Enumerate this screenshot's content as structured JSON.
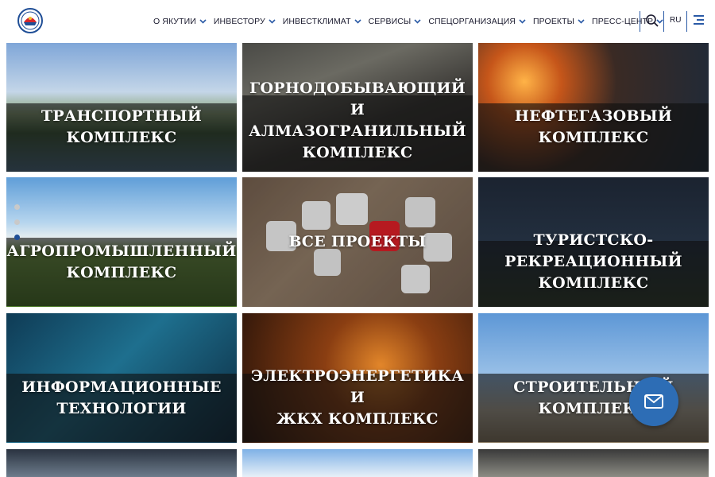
{
  "header": {
    "nav": [
      {
        "label": "О ЯКУТИИ"
      },
      {
        "label": "ИНВЕСТОРУ"
      },
      {
        "label": "ИНВЕСТКЛИМАТ"
      },
      {
        "label": "СЕРВИСЫ"
      },
      {
        "label": "СПЕЦОРГАНИЗАЦИЯ"
      },
      {
        "label": "ПРОЕКТЫ"
      },
      {
        "label": "ПРЕСС-ЦЕНТР"
      }
    ],
    "language": "RU",
    "icons": {
      "logo": "emblem-icon",
      "search": "search-icon",
      "menu": "hamburger-menu-icon"
    },
    "accent_color": "#2a5aa6"
  },
  "tiles": [
    {
      "label": "ТРАНСПОРТНЫЙ\nКОМПЛЕКС"
    },
    {
      "label": "ГОРНОДОБЫВАЮЩИЙ И\nАЛМАЗОГРАНИЛЬНЫЙ\nКОМПЛЕКС"
    },
    {
      "label": "НЕФТЕГАЗОВЫЙ\nКОМПЛЕКС"
    },
    {
      "label": "АГРОПРОМЫШЛЕННЫЙ\nКОМПЛЕКС"
    },
    {
      "label": "ВСЕ ПРОЕКТЫ"
    },
    {
      "label": "ТУРИСТСКО-\nРЕКРЕАЦИОННЫЙ\nКОМПЛЕКС"
    },
    {
      "label": "ИНФОРМАЦИОННЫЕ\nТЕХНОЛОГИИ"
    },
    {
      "label": "ЭЛЕКТРОЭНЕРГЕТИКА И\nЖКХ КОМПЛЕКС"
    },
    {
      "label": "СТРОИТЕЛЬНЫЙ\nКОМПЛЕКС"
    }
  ],
  "slider": {
    "dots": 3,
    "active_index": 2
  },
  "floating": {
    "icon": "mail-icon",
    "color": "#2d6db5"
  }
}
